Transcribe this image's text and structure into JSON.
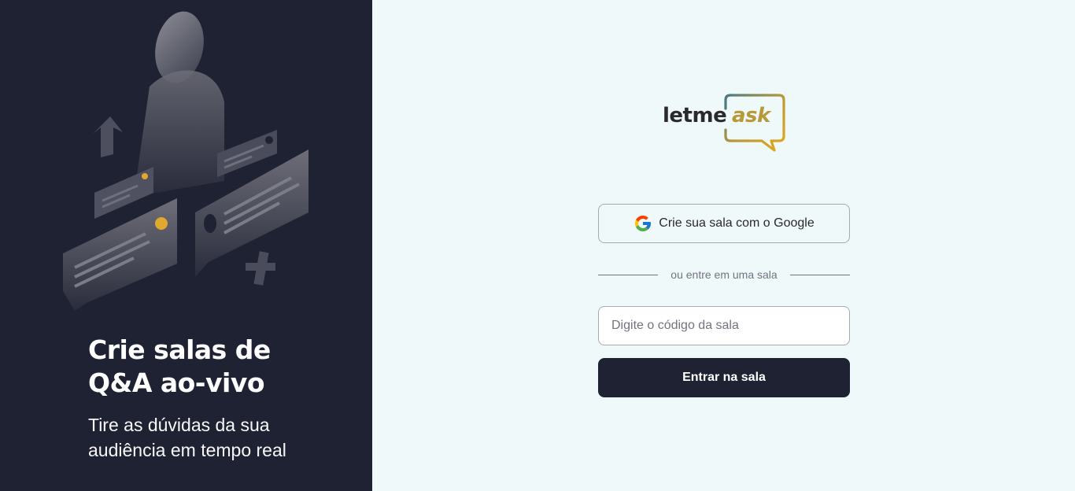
{
  "aside": {
    "illustration": "question-answer-illustration",
    "title": "Crie salas de Q&A ao-vivo",
    "subtitle": "Tire as dúvidas da sua audiência em tempo real"
  },
  "logo": {
    "text_letme": "letme",
    "text_ask": "ask"
  },
  "google_button": {
    "icon": "google-icon",
    "label": "Crie sua sala com o Google"
  },
  "separator": {
    "text": "ou entre em uma sala"
  },
  "room_code": {
    "value": "",
    "placeholder": "Digite o código da sala"
  },
  "enter_button": {
    "label": "Entrar na sala"
  },
  "colors": {
    "aside_bg": "#1f2233",
    "main_bg": "#eff9f9",
    "accent_gold": "#e0a82e",
    "button_dark": "#1f2233"
  }
}
